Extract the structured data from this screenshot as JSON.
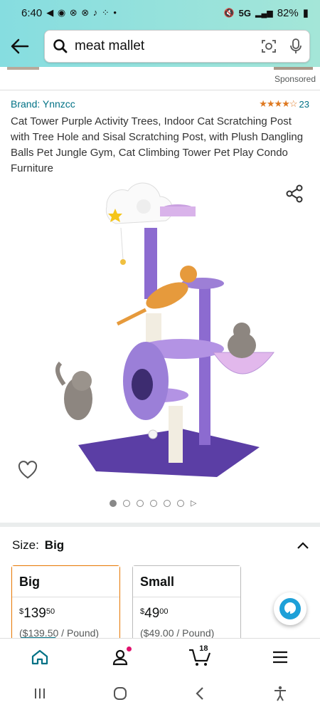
{
  "status": {
    "time": "6:40",
    "network": "5G",
    "battery": "82%"
  },
  "search": {
    "query": "meat mallet"
  },
  "sponsored_label": "Sponsored",
  "product": {
    "brand": "Brand: Ynnzcc",
    "rating_stars": "★★★★☆",
    "rating_count": "23",
    "title": "Cat Tower Purple Activity Trees, Indoor Cat Scratching Post with Tree Hole and Sisal Scratching Post, with Plush Dangling Balls Pet Jungle Gym, Cat Climbing Tower Pet Play Condo Furniture",
    "image_count": 6,
    "image_active_index": 0
  },
  "size": {
    "label": "Size:",
    "selected": "Big",
    "options": [
      {
        "name": "Big",
        "price_symbol": "$",
        "price_whole": "139",
        "price_fraction": "50",
        "unit_price": "($139.50 / Pound)"
      },
      {
        "name": "Small",
        "price_symbol": "$",
        "price_whole": "49",
        "price_fraction": "00",
        "unit_price": "($49.00 / Pound)"
      }
    ]
  },
  "cart": {
    "count": "18"
  },
  "colors": {
    "teal": "#007185",
    "header": "#86dde0",
    "star": "#de7921",
    "selected_border": "#e77600"
  }
}
